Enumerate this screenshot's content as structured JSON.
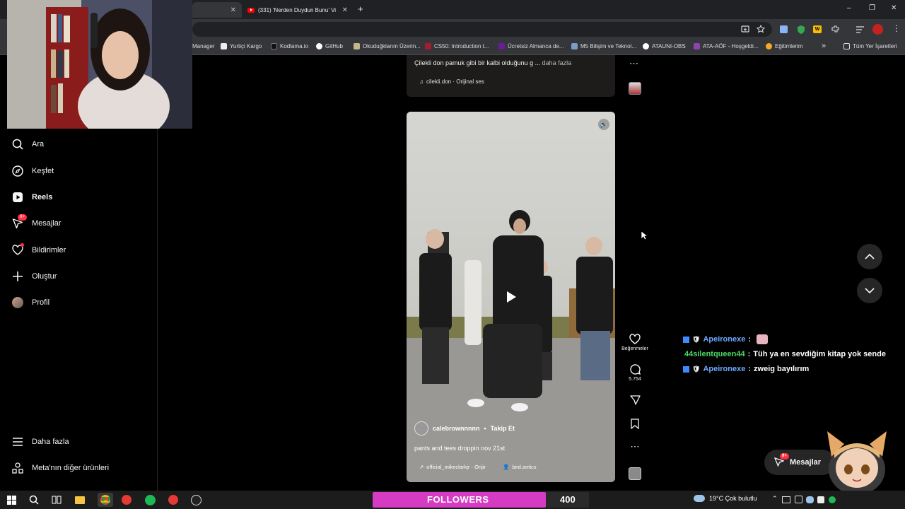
{
  "browser": {
    "tabs": [
      {
        "title": "",
        "active": true
      },
      {
        "title": "(331) 'Nerden Duydun Bunu' Vi",
        "active": false
      }
    ],
    "new_tab": "+",
    "window_controls": {
      "minimize": "–",
      "restore": "❐",
      "close": "✕"
    },
    "bookmarks": [
      {
        "label": "Manager",
        "icon": "bookmark-icon"
      },
      {
        "label": "Yurtiçi Kargo",
        "icon": "yurtici-icon"
      },
      {
        "label": "Kodlama.io",
        "icon": "kodlama-icon"
      },
      {
        "label": "GitHub",
        "icon": "github-icon"
      },
      {
        "label": "Okuduğklarım Üzerin...",
        "icon": "book-icon"
      },
      {
        "label": "CS50: Introduction t...",
        "icon": "cs50-icon"
      },
      {
        "label": "Ücretsiz Almanca de...",
        "icon": "german-icon"
      },
      {
        "label": "M5 Bilişim ve Teknol...",
        "icon": "m5-icon"
      },
      {
        "label": "ATAUNI-OBS",
        "icon": "ataturk-icon"
      },
      {
        "label": "ATA-AÖF - Hoşgeldi...",
        "icon": "ata-aof-icon"
      },
      {
        "label": "Eğitimlerim",
        "icon": "education-icon"
      }
    ],
    "bookmarks_more": "»",
    "all_bookmarks": "Tüm Yer İşaretleri"
  },
  "sidebar": {
    "items": [
      {
        "label": "Ara",
        "icon": "search-icon",
        "badge": ""
      },
      {
        "label": "Keşfet",
        "icon": "compass-icon",
        "badge": ""
      },
      {
        "label": "Reels",
        "icon": "reels-icon",
        "badge": ""
      },
      {
        "label": "Mesajlar",
        "icon": "messenger-icon",
        "badge": "9+"
      },
      {
        "label": "Bildirimler",
        "icon": "heart-icon",
        "badge": ""
      },
      {
        "label": "Oluştur",
        "icon": "plus-icon",
        "badge": ""
      },
      {
        "label": "Profil",
        "icon": "avatar-icon",
        "badge": ""
      }
    ],
    "bottom": [
      {
        "label": "Daha fazla",
        "icon": "menu-icon"
      },
      {
        "label": "Meta'nın diğer ürünleri",
        "icon": "grid-icon"
      }
    ]
  },
  "reel_previous": {
    "caption": "Çilekli don pamuk gibi bir kalbi olduğunu g ...",
    "more": "daha fazla",
    "audio": "cilekli.don · Orijinal ses"
  },
  "reel_current": {
    "username": "calebrownnnnn",
    "separator": "•",
    "follow": "Takip Et",
    "caption": "pants and tees droppin nov 21st",
    "audio": "official_mikeclarkjr · Orijir",
    "tagged": "bird.antics",
    "likes_label": "Beğenmeler",
    "comments_count": "5.754"
  },
  "chat": [
    {
      "user": "Apeironexe",
      "message": "",
      "color": "#6ea8ff"
    },
    {
      "user": "44silentqueen44",
      "message": "Tüh ya en sevdiğim kitap yok sende",
      "color": "#4cd964"
    },
    {
      "user": "Apeironexe",
      "message": "zweig bayılırım",
      "color": "#6ea8ff"
    }
  ],
  "messages_pill": {
    "label": "Mesajlar",
    "badge": "9+"
  },
  "followers_widget": {
    "label": "FOLLOWERS",
    "count": "400"
  },
  "taskbar": {
    "weather": "19°C  Çok bulutlu"
  },
  "colors": {
    "accent_red": "#ff3040",
    "followers_pink": "#d63bc4",
    "chat_blue": "#6ea8ff",
    "chat_green": "#4cd964"
  }
}
